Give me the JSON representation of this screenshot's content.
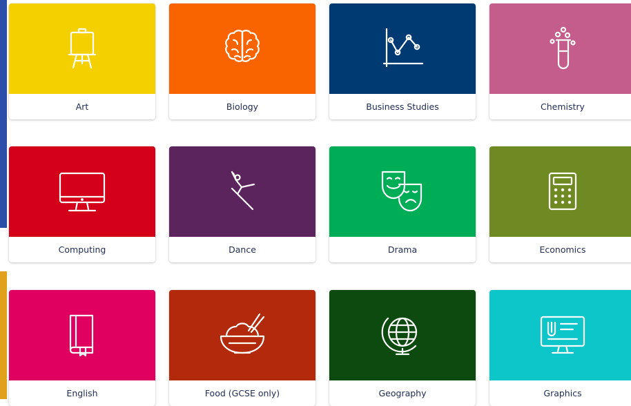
{
  "subjects": [
    {
      "label": "Art",
      "color": "#f5d000",
      "icon": "easel-icon"
    },
    {
      "label": "Biology",
      "color": "#fa6400",
      "icon": "brain-icon"
    },
    {
      "label": "Business Studies",
      "color": "#003a73",
      "icon": "line-chart-icon"
    },
    {
      "label": "Chemistry",
      "color": "#c45c8c",
      "icon": "test-tube-icon"
    },
    {
      "label": "Computing",
      "color": "#d4001a",
      "icon": "monitor-icon"
    },
    {
      "label": "Dance",
      "color": "#5c245c",
      "icon": "dancer-icon"
    },
    {
      "label": "Drama",
      "color": "#00ad57",
      "icon": "theatre-masks-icon"
    },
    {
      "label": "Economics",
      "color": "#6f8a22",
      "icon": "calculator-icon"
    },
    {
      "label": "English",
      "color": "#e0005f",
      "icon": "book-icon"
    },
    {
      "label": "Food (GCSE only)",
      "color": "#b3290c",
      "icon": "rice-bowl-icon"
    },
    {
      "label": "Geography",
      "color": "#0d4a0f",
      "icon": "globe-icon"
    },
    {
      "label": "Graphics",
      "color": "#0dc6c9",
      "icon": "design-screen-icon"
    }
  ]
}
